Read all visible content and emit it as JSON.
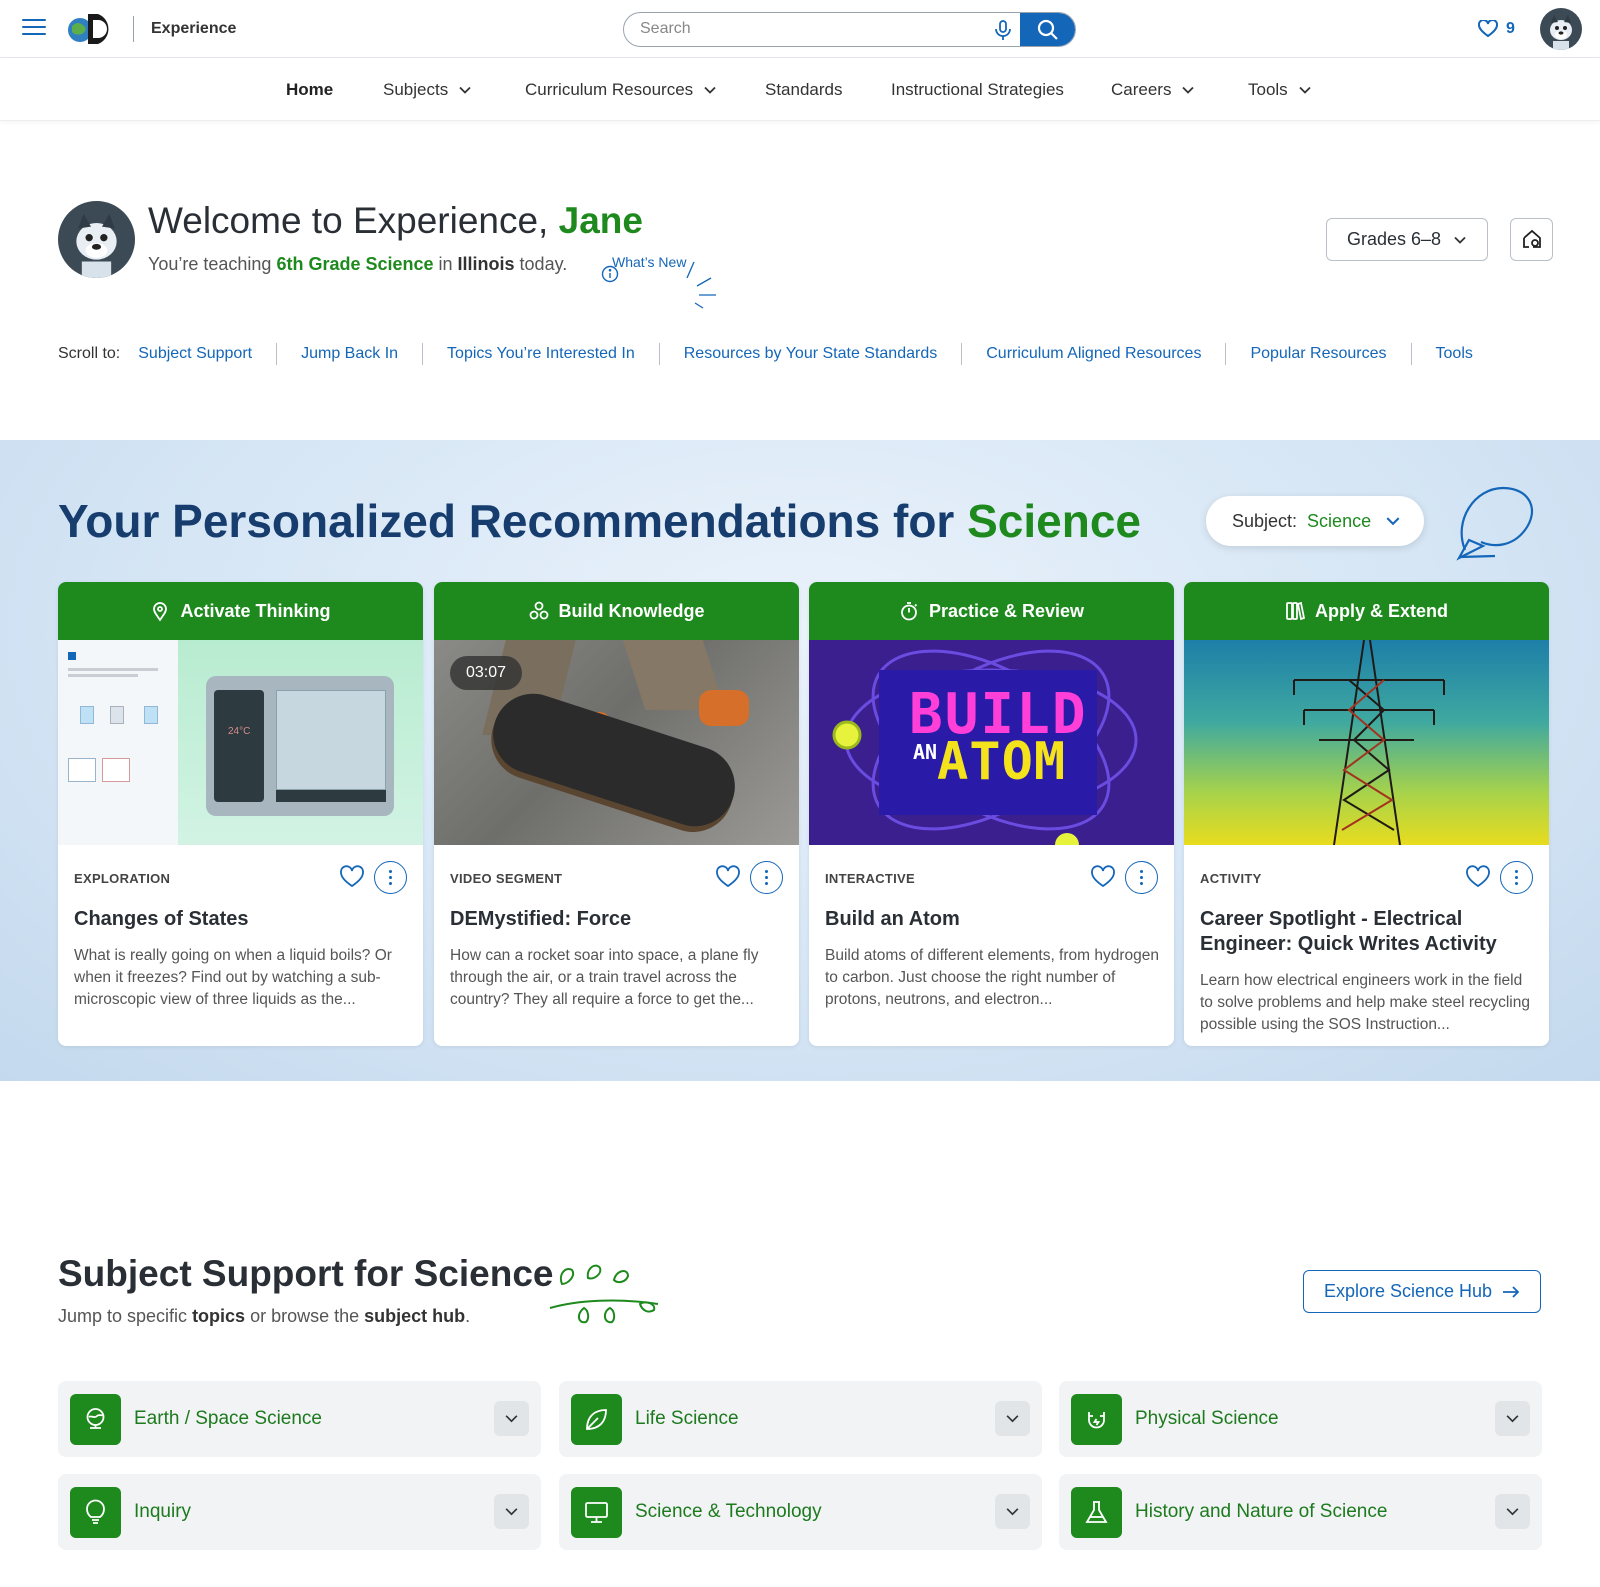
{
  "app": {
    "name": "Experience"
  },
  "search": {
    "placeholder": "Search"
  },
  "favorites": {
    "count": "9"
  },
  "nav": {
    "home": "Home",
    "subjects": "Subjects",
    "curriculum": "Curriculum Resources",
    "standards": "Standards",
    "strategies": "Instructional Strategies",
    "careers": "Careers",
    "tools": "Tools"
  },
  "welcome": {
    "prefix": "Welcome to Experience, ",
    "name": "Jane",
    "sub_prefix": "You’re teaching ",
    "course": "6th Grade Science",
    "sub_mid": " in ",
    "state": "Illinois",
    "sub_suffix": " today.",
    "whats_new": "What’s New"
  },
  "grades": {
    "label": "Grades 6–8"
  },
  "scroll_to": {
    "label": "Scroll to:",
    "links": [
      "Subject Support",
      "Jump Back In",
      "Topics You’re Interested In",
      "Resources by Your State Standards",
      "Curriculum Aligned Resources",
      "Popular Resources",
      "Tools"
    ]
  },
  "recommendations": {
    "title_prefix": "Your Personalized Recommendations for ",
    "title_subject": "Science",
    "subject_label": "Subject:",
    "subject_value": "Science",
    "cards": [
      {
        "header": "Activate Thinking",
        "type": "EXPLORATION",
        "title": "Changes of States",
        "description": "What is really going on when a liquid boils? Or when it freezes? Find out by watching a sub-microscopic view of three liquids as the...",
        "thumb_temp": "24°C"
      },
      {
        "header": "Build Knowledge",
        "type": "VIDEO SEGMENT",
        "title": "DEMystified: Force",
        "description": "How can a rocket soar into space, a plane fly through the air, or a train travel across the country? They all require a force to get the...",
        "duration": "03:07"
      },
      {
        "header": "Practice & Review",
        "type": "INTERACTIVE",
        "title": "Build an Atom",
        "description": "Build atoms of different elements, from hydrogen to carbon. Just choose the right number of protons, neutrons, and electron...",
        "thumb_line1": "BUILD",
        "thumb_an": "AN",
        "thumb_line2": "ATOM"
      },
      {
        "header": "Apply & Extend",
        "type": "ACTIVITY",
        "title": "Career Spotlight - Electrical Engineer: Quick Writes Activity",
        "description": "Learn how electrical engineers work in the field to solve problems and help make steel recycling possible using the SOS Instruction..."
      }
    ]
  },
  "subject_support": {
    "title": "Subject Support for Science",
    "sub_prefix": "Jump to specific ",
    "sub_topics": "topics",
    "sub_mid": " or browse the ",
    "sub_hub": "subject hub",
    "sub_suffix": ".",
    "explore_label": "Explore Science Hub",
    "tiles": [
      "Earth / Space Science",
      "Life Science",
      "Physical Science",
      "Inquiry",
      "Science & Technology",
      "History and Nature of Science"
    ]
  },
  "colors": {
    "brand_blue": "#1466b8",
    "brand_green": "#1e8a1e",
    "title_navy": "#163d6e"
  }
}
